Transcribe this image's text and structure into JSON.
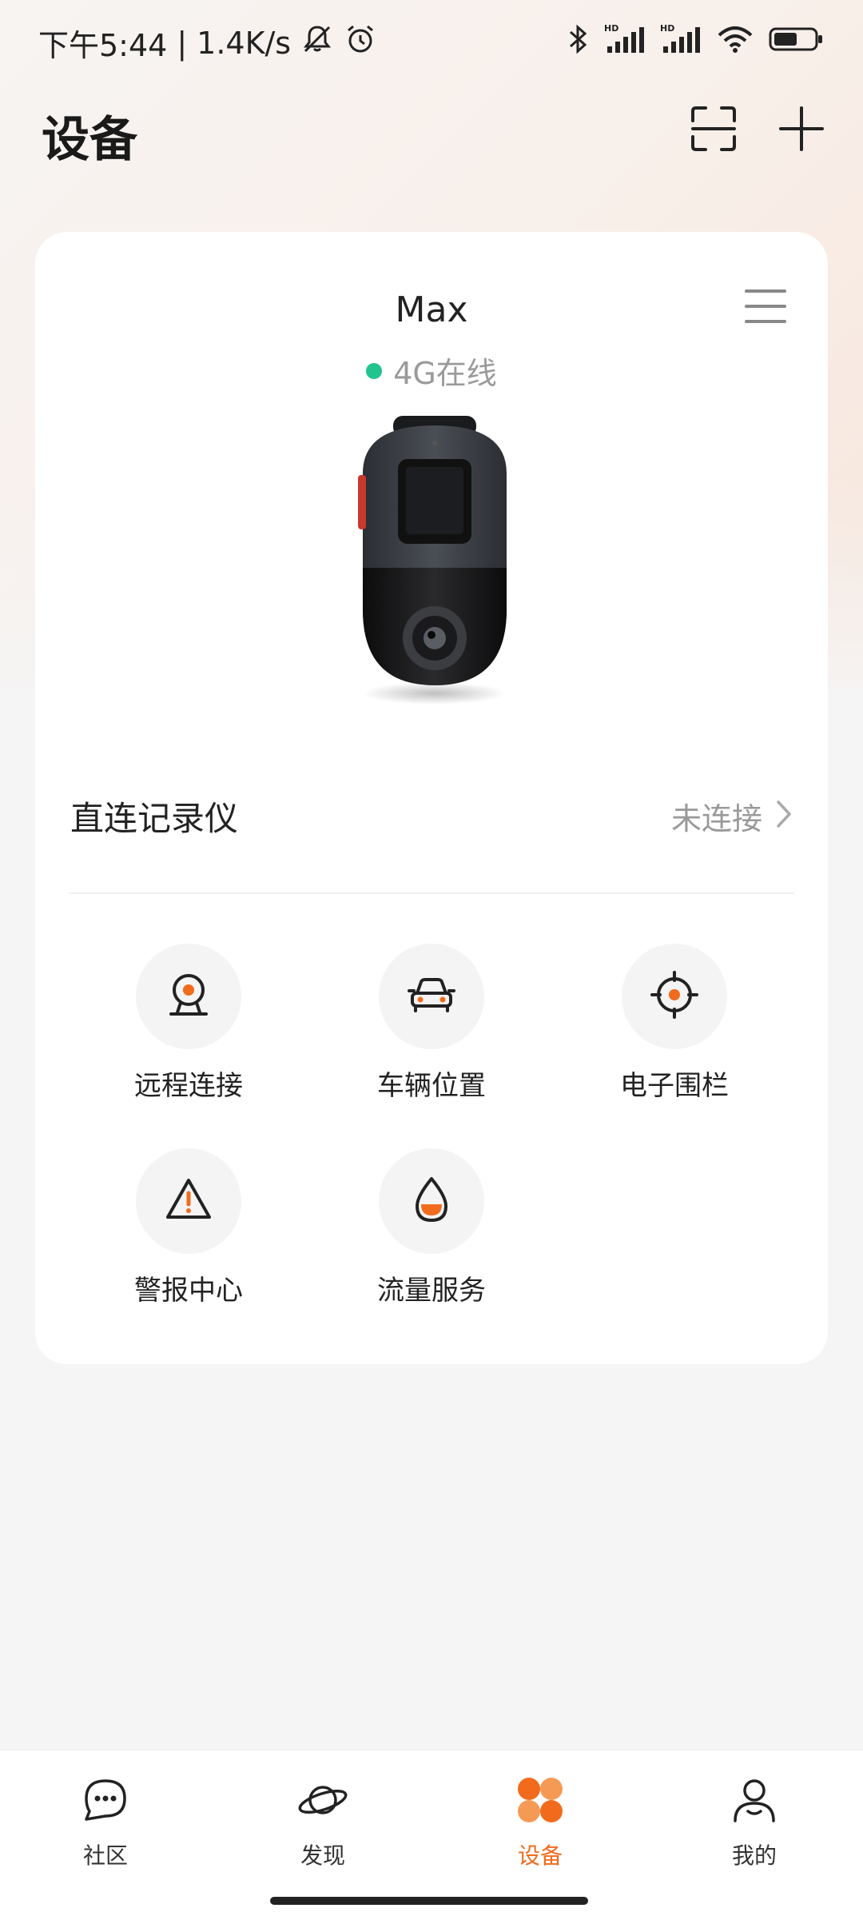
{
  "status_bar": {
    "time": "下午5:44",
    "separator": "|",
    "network_speed": "1.4K/s",
    "icons": [
      "mute-bell-icon",
      "alarm-icon",
      "bluetooth-icon",
      "signal-hd-icon",
      "signal-hd-icon",
      "wifi-icon",
      "battery-icon"
    ],
    "hd_label": "HD"
  },
  "header": {
    "title": "设备",
    "scan_icon": "scan-icon",
    "add_icon": "plus-icon"
  },
  "device_card": {
    "name": "Max",
    "status": "4G在线",
    "status_color": "#22c38e",
    "direct_row": {
      "label": "直连记录仪",
      "value": "未连接"
    },
    "features": [
      {
        "label": "远程连接",
        "icon": "webcam-icon"
      },
      {
        "label": "车辆位置",
        "icon": "car-icon"
      },
      {
        "label": "电子围栏",
        "icon": "target-icon"
      },
      {
        "label": "警报中心",
        "icon": "warning-icon"
      },
      {
        "label": "流量服务",
        "icon": "droplet-icon"
      }
    ]
  },
  "bottom_nav": {
    "items": [
      {
        "label": "社区",
        "icon": "chat-bubble-icon",
        "active": false
      },
      {
        "label": "发现",
        "icon": "planet-icon",
        "active": false
      },
      {
        "label": "设备",
        "icon": "grid-clover-icon",
        "active": true
      },
      {
        "label": "我的",
        "icon": "person-icon",
        "active": false
      }
    ]
  },
  "colors": {
    "accent": "#f26b1d",
    "online": "#22c38e",
    "card_bg": "#ffffff",
    "page_bg": "#f5f5f5"
  }
}
